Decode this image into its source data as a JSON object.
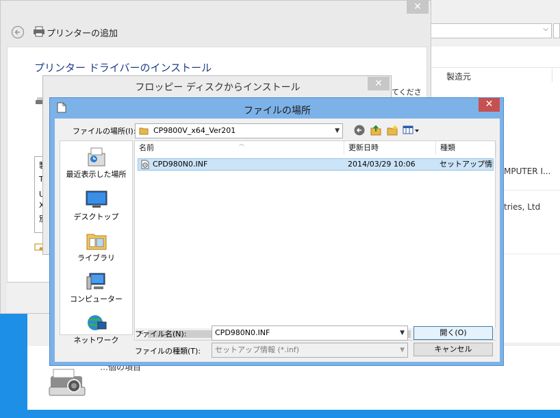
{
  "background": {
    "column_header": "製造元",
    "rows": [
      "MPUTER I...",
      "tries, Ltd"
    ],
    "count_text": "…個の項目"
  },
  "wizard": {
    "title": "プリンターの追加",
    "heading": "プリンター ドライバーのインストール",
    "partial_right": "てくださ",
    "partial_left": [
      "製",
      "T",
      "U",
      "X",
      "別"
    ],
    "close_glyph": "✕"
  },
  "floppy": {
    "title": "フロッピー ディスクからインストール",
    "close_glyph": "✕"
  },
  "dialog": {
    "title": "ファイルの場所",
    "close_glyph": "✕",
    "location_label": "ファイルの場所(I):",
    "location_value": "CP9800V_x64_Ver201",
    "places": [
      {
        "label": "最近表示した場所",
        "icon": "recent-places-icon"
      },
      {
        "label": "デスクトップ",
        "icon": "desktop-icon"
      },
      {
        "label": "ライブラリ",
        "icon": "libraries-icon"
      },
      {
        "label": "コンピューター",
        "icon": "computer-icon"
      },
      {
        "label": "ネットワーク",
        "icon": "network-icon"
      }
    ],
    "columns": [
      "名前",
      "更新日時",
      "種類"
    ],
    "files": [
      {
        "name": "CPD980N0.INF",
        "modified": "2014/03/29 10:06",
        "type": "セットアップ情報"
      }
    ],
    "filename_label": "ファイル名(N):",
    "filename_value": "CPD980N0.INF",
    "filetype_label": "ファイルの種類(T):",
    "filetype_value": "セットアップ情報 (*.inf)",
    "open_button": "開く(O)",
    "cancel_button": "キャンセル"
  },
  "colors": {
    "desktop": "#1e8fe6",
    "dialog_frame": "#7db2e8",
    "close_red": "#c75050",
    "selection": "#cce4f7",
    "heading_blue": "#1e3a8a"
  }
}
